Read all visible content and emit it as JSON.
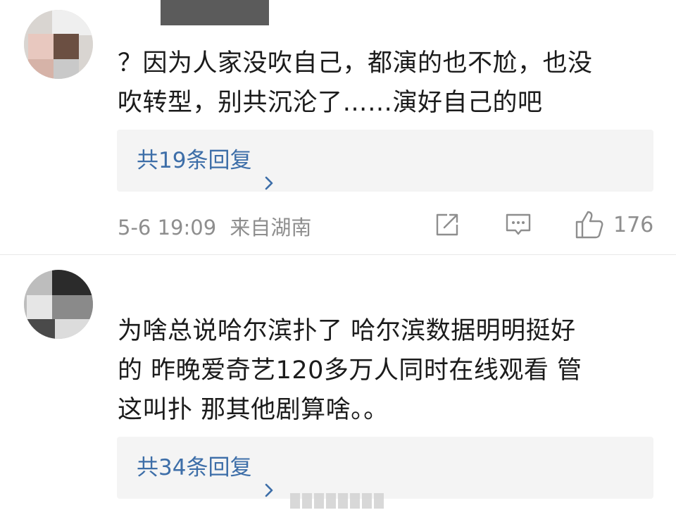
{
  "comments": [
    {
      "text_line1": "？因为人家没吹自己，都演的也不尬，也没",
      "text_line2": "吹转型，别共沉沦了……演好自己的吧",
      "replies_label": "共19条回复",
      "time": "5-6 19:09",
      "location": "来自湖南",
      "like_count": "176"
    },
    {
      "text_line1": "为啥总说哈尔滨扑了 哈尔滨数据明明挺好",
      "text_line2": "的 昨晚爱奇艺120多万人同时在线观看 管",
      "text_line3": "这叫扑 那其他剧算啥。。",
      "replies_label": "共34条回复"
    }
  ],
  "icons": {
    "share": "share-icon",
    "comment": "comment-icon",
    "like": "thumbs-up-icon",
    "chevron": "chevron-right-icon"
  },
  "colors": {
    "link": "#3d6ea8",
    "meta_gray": "#8e8e8e",
    "reply_bg": "#f4f4f4"
  }
}
